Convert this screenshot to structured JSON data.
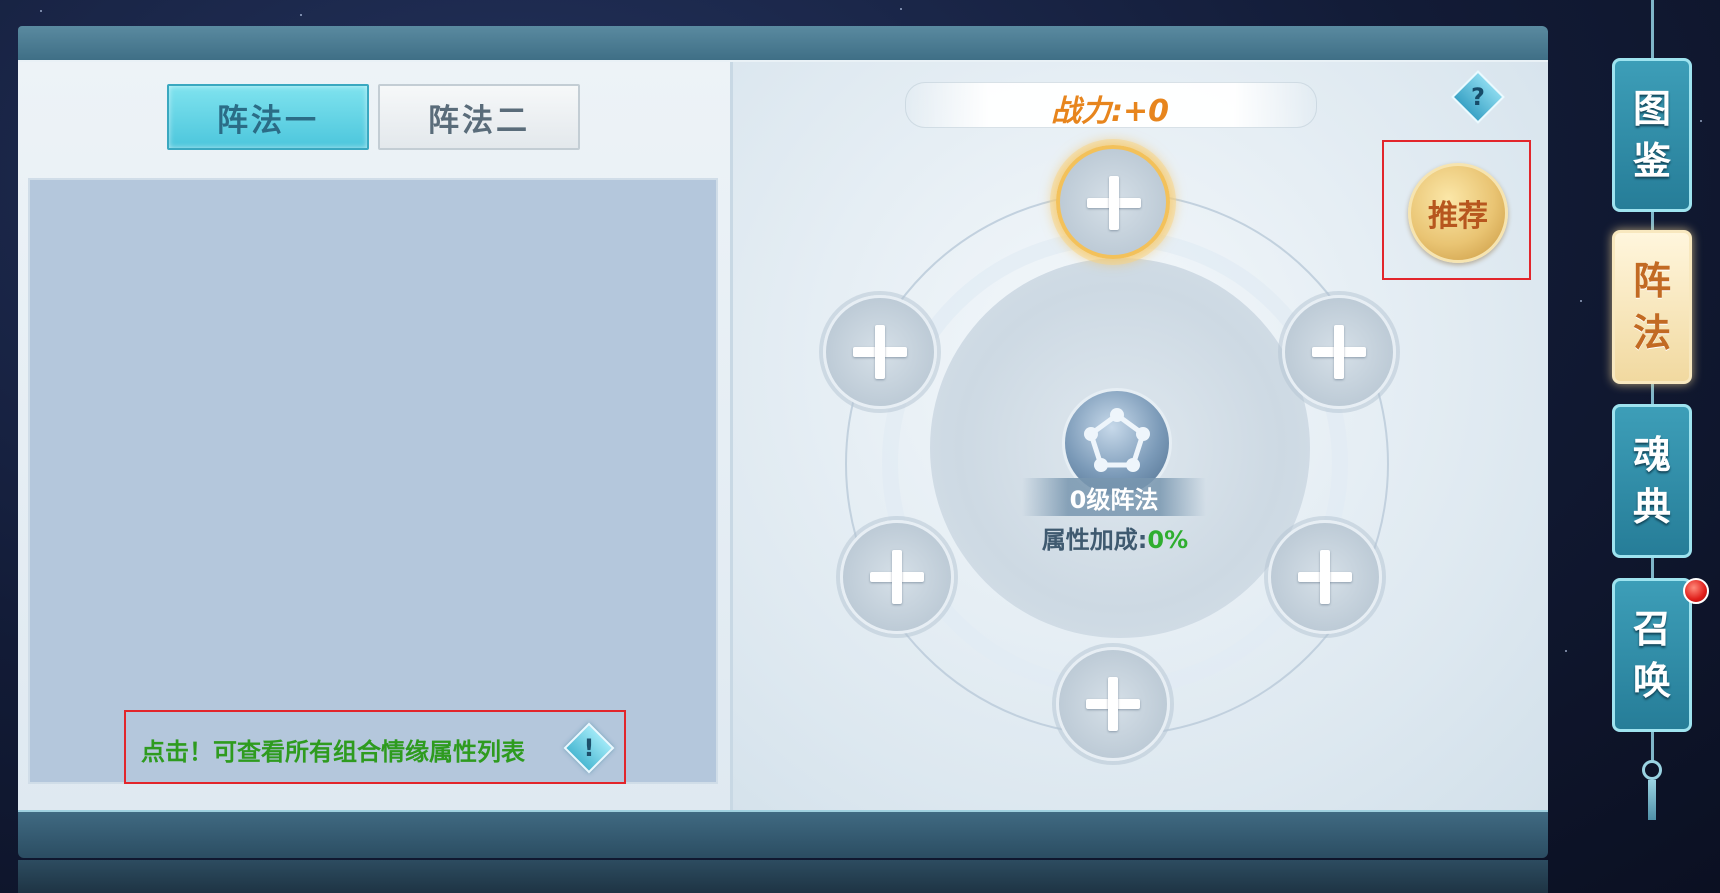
{
  "tabs": {
    "formation_one": "阵法一",
    "formation_two": "阵法二"
  },
  "hint": {
    "text": "点击！可查看所有组合情缘属性列表",
    "icon_glyph": "!"
  },
  "power": {
    "label": "战力:+0"
  },
  "help": {
    "glyph": "?"
  },
  "recommend": {
    "label": "推荐"
  },
  "formation": {
    "level_label": "0级阵法",
    "bonus_label": "属性加成:",
    "bonus_value": "0%",
    "slot_count": 6
  },
  "side_nav": {
    "items": [
      {
        "label_top": "图",
        "label_bottom": "鉴",
        "active": false
      },
      {
        "label_top": "阵",
        "label_bottom": "法",
        "active": true
      },
      {
        "label_top": "魂",
        "label_bottom": "典",
        "active": false
      },
      {
        "label_top": "召",
        "label_bottom": "唤",
        "active": false,
        "notification": true
      }
    ]
  },
  "colors": {
    "accent_cyan": "#4cc6dc",
    "power_orange": "#e7851d",
    "bonus_green": "#2fae2f",
    "hint_green": "#2e9b1f",
    "highlight_red": "#e2252b"
  }
}
